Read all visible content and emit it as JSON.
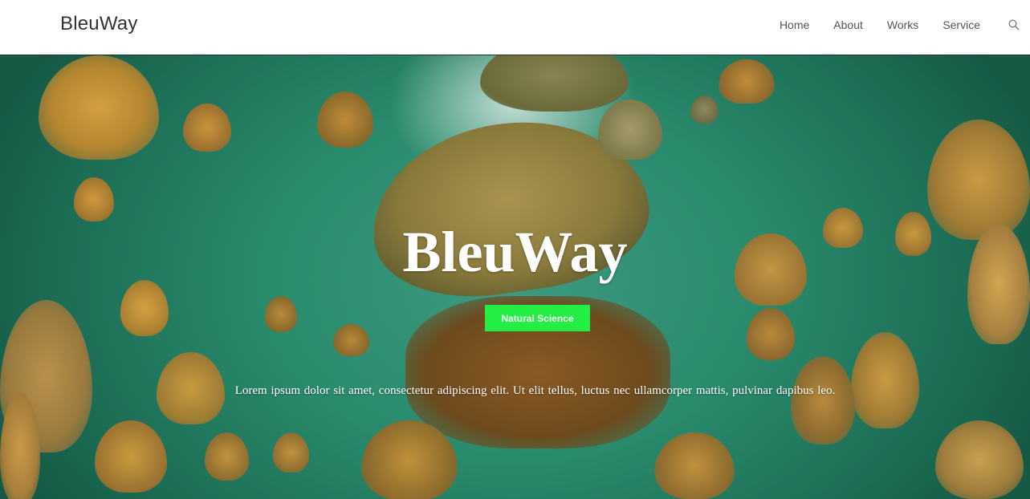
{
  "header": {
    "logo": "BleuWay",
    "nav": [
      "Home",
      "About",
      "Works",
      "Service"
    ],
    "search_icon": "search-icon"
  },
  "hero": {
    "title": "BleuWay",
    "button_label": "Natural Science",
    "text": "Lorem ipsum dolor sit amet, consectetur adipiscing elit. Ut elit tellus, luctus nec ullamcorper mattis, pulvinar dapibus leo.",
    "background": "jellyfish-underwater-photo"
  },
  "colors": {
    "accent": "#22ee44",
    "water": "#2a8a6c",
    "jelly": "#b08a3a"
  }
}
